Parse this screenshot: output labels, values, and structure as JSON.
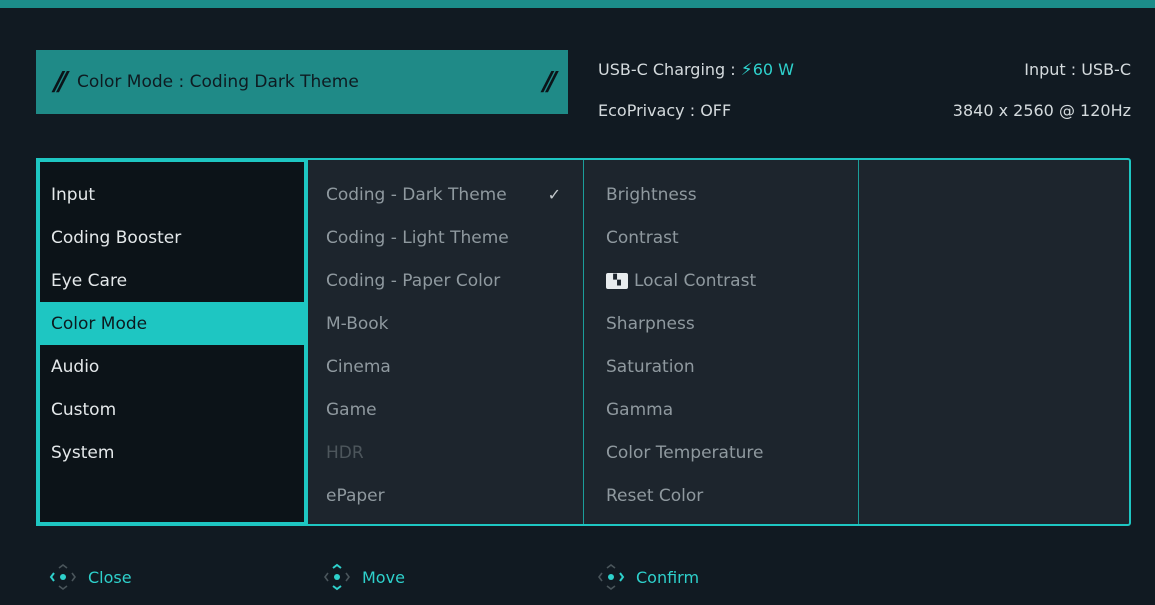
{
  "header": {
    "mode_label": "Color Mode : Coding Dark Theme",
    "slash_glyph": "//",
    "charging_label": "USB-C Charging :",
    "charging_value": "60 W",
    "input_label": "Input : USB-C",
    "eco_privacy": "EcoPrivacy : OFF",
    "resolution": "3840 x 2560 @ 120Hz"
  },
  "main_menu": [
    {
      "label": "Input"
    },
    {
      "label": "Coding Booster"
    },
    {
      "label": "Eye Care"
    },
    {
      "label": "Color Mode"
    },
    {
      "label": "Audio"
    },
    {
      "label": "Custom"
    },
    {
      "label": "System"
    }
  ],
  "color_modes": [
    {
      "label": "Coding - Dark Theme"
    },
    {
      "label": "Coding - Light Theme"
    },
    {
      "label": "Coding - Paper Color"
    },
    {
      "label": "M-Book"
    },
    {
      "label": "Cinema"
    },
    {
      "label": "Game"
    },
    {
      "label": "HDR"
    },
    {
      "label": "ePaper"
    }
  ],
  "selected_mode_check": "✓",
  "settings": [
    {
      "label": "Brightness"
    },
    {
      "label": "Contrast"
    },
    {
      "label": "Local Contrast"
    },
    {
      "label": "Sharpness"
    },
    {
      "label": "Saturation"
    },
    {
      "label": "Gamma"
    },
    {
      "label": "Color Temperature"
    },
    {
      "label": "Reset Color"
    }
  ],
  "footer": {
    "close": "Close",
    "move": "Move",
    "confirm": "Confirm"
  },
  "colors": {
    "accent": "#1ec6c2",
    "banner": "#1f8a87",
    "background": "#111a22",
    "panel": "#1d252d"
  },
  "icons": {
    "bolt": "charging-icon",
    "local_contrast": "local-contrast-icon",
    "nav": "joystick-icon"
  }
}
